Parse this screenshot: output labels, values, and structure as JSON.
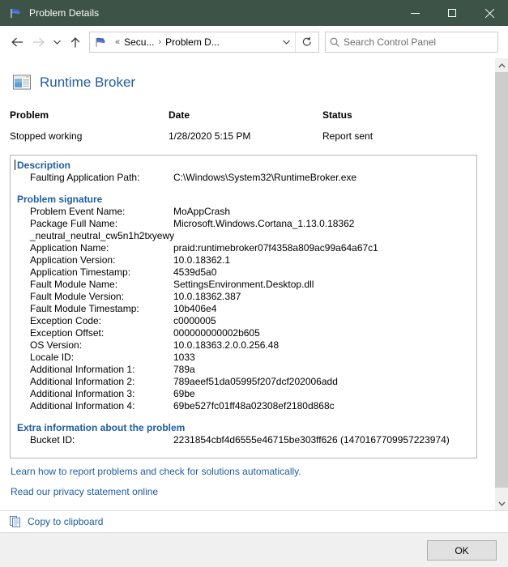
{
  "window": {
    "title": "Problem Details",
    "icon": "flag-icon",
    "minimize_label": "Minimize",
    "maximize_label": "Maximize",
    "close_label": "Close"
  },
  "navbar": {
    "back_label": "Back",
    "forward_label": "Forward",
    "recent_label": "Recent locations",
    "up_label": "Up one level",
    "breadcrumbs": [
      "Secu...",
      "Problem D..."
    ],
    "overflow_chevrons": "«",
    "separator": "›",
    "dropdown_label": "Previous locations",
    "refresh_label": "Refresh",
    "search_placeholder": "Search Control Panel"
  },
  "app": {
    "icon": "application-window-icon",
    "name": "Runtime Broker"
  },
  "summary": {
    "problem_label": "Problem",
    "problem_value": "Stopped working",
    "date_label": "Date",
    "date_value": "1/28/2020 5:15 PM",
    "status_label": "Status",
    "status_value": "Report sent"
  },
  "details": {
    "description": {
      "title": "Description",
      "rows": [
        {
          "key": "Faulting Application Path:",
          "value": "C:\\Windows\\System32\\RuntimeBroker.exe"
        }
      ]
    },
    "problem_signature": {
      "title": "Problem signature",
      "rows": [
        {
          "key": "Problem Event Name:",
          "value": "MoAppCrash"
        },
        {
          "key": "Package Full Name:",
          "value": "Microsoft.Windows.Cortana_1.13.0.18362",
          "continuation": "_neutral_neutral_cw5n1h2txyewy"
        },
        {
          "key": "Application Name:",
          "value": "praid:runtimebroker07f4358a809ac99a64a67c1"
        },
        {
          "key": "Application Version:",
          "value": "10.0.18362.1"
        },
        {
          "key": "Application Timestamp:",
          "value": "4539d5a0"
        },
        {
          "key": "Fault Module Name:",
          "value": "SettingsEnvironment.Desktop.dll"
        },
        {
          "key": "Fault Module Version:",
          "value": "10.0.18362.387"
        },
        {
          "key": "Fault Module Timestamp:",
          "value": "10b406e4"
        },
        {
          "key": "Exception Code:",
          "value": "c0000005"
        },
        {
          "key": "Exception Offset:",
          "value": "000000000002b605"
        },
        {
          "key": "OS Version:",
          "value": "10.0.18363.2.0.0.256.48"
        },
        {
          "key": "Locale ID:",
          "value": "1033"
        },
        {
          "key": "Additional Information 1:",
          "value": "789a"
        },
        {
          "key": "Additional Information 2:",
          "value": "789aeef51da05995f207dcf202006add"
        },
        {
          "key": "Additional Information 3:",
          "value": "69be"
        },
        {
          "key": "Additional Information 4:",
          "value": "69be527fc01ff48a02308ef2180d868c"
        }
      ]
    },
    "extra": {
      "title": "Extra information about the problem",
      "rows": [
        {
          "key": "Bucket ID:",
          "value": "2231854cbf4d6555e46715be303ff626 (1470167709957223974)"
        }
      ]
    }
  },
  "links": [
    {
      "text": "Learn how to report problems and check for solutions automatically."
    },
    {
      "text": "Read our privacy statement online"
    }
  ],
  "bottom": {
    "copy_icon": "copy-document-icon",
    "copy_label": "Copy to clipboard"
  },
  "footer": {
    "ok_label": "OK"
  },
  "scrollbar": {
    "up_glyph": "∧",
    "down_glyph": "∨"
  },
  "colors": {
    "titlebar": "#3d5347",
    "link": "#1f5da0",
    "section_heading": "#1f5da0",
    "footer": "#f0f0f0"
  }
}
